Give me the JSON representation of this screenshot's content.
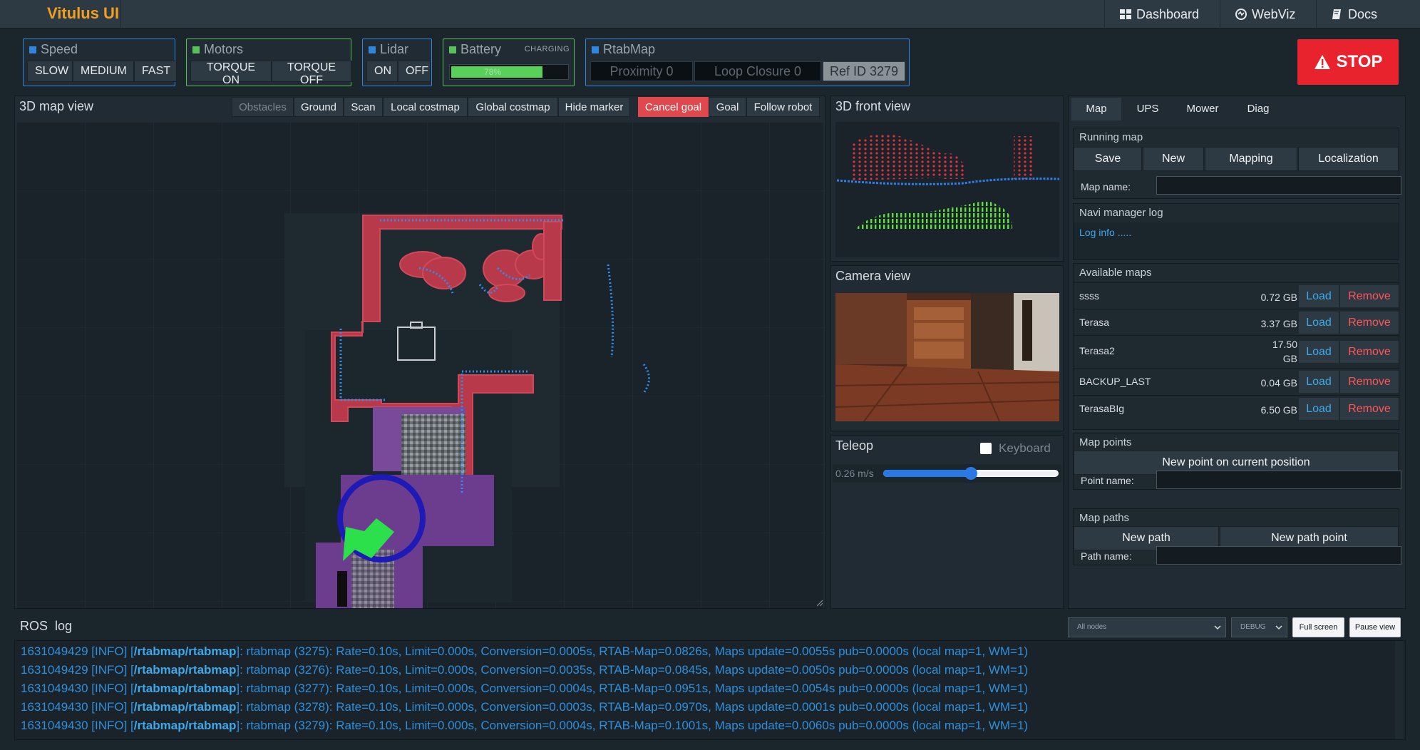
{
  "nav": {
    "brand": "Vitulus UI",
    "links": [
      "Dashboard",
      "WebViz",
      "Docs"
    ]
  },
  "status": {
    "speed": {
      "title": "Speed",
      "buttons": [
        "SLOW",
        "MEDIUM",
        "FAST"
      ],
      "color": "#2e86e0"
    },
    "motors": {
      "title": "Motors",
      "buttons": [
        "TORQUE ON",
        "TORQUE OFF"
      ],
      "color": "#58c159"
    },
    "lidar": {
      "title": "Lidar",
      "buttons": [
        "ON",
        "OFF"
      ],
      "color": "#2e86e0"
    },
    "battery": {
      "title": "Battery",
      "state": "CHARGING",
      "percent_label": "78%",
      "level": 0.78,
      "color": "#58c159"
    },
    "rtabmap": {
      "title": "RtabMap",
      "proximity": "Proximity 0",
      "loop_closure": "Loop Closure 0",
      "ref_id": "Ref ID 3279",
      "color": "#2e86e0"
    }
  },
  "stop": {
    "label": "STOP"
  },
  "map3d": {
    "title": "3D map view",
    "buttons": [
      "Obstacles",
      "Ground",
      "Scan",
      "Local costmap",
      "Global costmap",
      "Hide marker"
    ],
    "goal_buttons": [
      "Cancel goal",
      "Goal",
      "Follow robot"
    ]
  },
  "front_view": {
    "title": "3D front view"
  },
  "camera_view": {
    "title": "Camera view"
  },
  "teleop": {
    "title": "Teleop",
    "keyboard_label": "Keyboard",
    "speed_label": "0.26 m/s",
    "slider_level": 0.5
  },
  "right": {
    "tabs": [
      "Map",
      "UPS",
      "Mower",
      "Diag"
    ],
    "running_map": {
      "title": "Running map",
      "buttons": [
        "Save",
        "New",
        "Mapping",
        "Localization"
      ],
      "map_name_label": "Map name:"
    },
    "navi_log": {
      "title": "Navi manager log",
      "text": "Log info ....."
    },
    "available_maps": {
      "title": "Available maps",
      "load_label": "Load",
      "remove_label": "Remove",
      "rows": [
        {
          "name": "ssss",
          "size": "0.72 GB"
        },
        {
          "name": "Terasa",
          "size": "3.37 GB"
        },
        {
          "name": "Terasa2",
          "size": "17.50 GB"
        },
        {
          "name": "BACKUP_LAST",
          "size": "0.04 GB"
        },
        {
          "name": "TerasaBIg",
          "size": "6.50 GB"
        }
      ]
    },
    "map_points": {
      "title": "Map points",
      "button": "New point on current position",
      "label": "Point name:"
    },
    "map_paths": {
      "title": "Map paths",
      "buttons": [
        "New path",
        "New path point"
      ],
      "label": "Path name:"
    }
  },
  "ros_log": {
    "title": "ROS  log",
    "node_filter": "All nodes",
    "level_filter": "DEBUG",
    "fullscreen_label": "Full screen",
    "pause_label": "Pause view",
    "lines": [
      {
        "ts": "1631049429 [INFO] [",
        "node": "/rtabmap/rtabmap",
        "msg": "]: rtabmap (3275): Rate=0.10s, Limit=0.000s, Conversion=0.0005s, RTAB-Map=0.0826s, Maps update=0.0055s pub=0.0000s (local map=1, WM=1)"
      },
      {
        "ts": "1631049429 [INFO] [",
        "node": "/rtabmap/rtabmap",
        "msg": "]: rtabmap (3276): Rate=0.10s, Limit=0.000s, Conversion=0.0035s, RTAB-Map=0.0845s, Maps update=0.0050s pub=0.0000s (local map=1, WM=1)"
      },
      {
        "ts": "1631049430 [INFO] [",
        "node": "/rtabmap/rtabmap",
        "msg": "]: rtabmap (3277): Rate=0.10s, Limit=0.000s, Conversion=0.0004s, RTAB-Map=0.0951s, Maps update=0.0054s pub=0.0000s (local map=1, WM=1)"
      },
      {
        "ts": "1631049430 [INFO] [",
        "node": "/rtabmap/rtabmap",
        "msg": "]: rtabmap (3278): Rate=0.10s, Limit=0.000s, Conversion=0.0003s, RTAB-Map=0.0970s, Maps update=0.0001s pub=0.0000s (local map=1, WM=1)"
      },
      {
        "ts": "1631049430 [INFO] [",
        "node": "/rtabmap/rtabmap",
        "msg": "]: rtabmap (3279): Rate=0.10s, Limit=0.000s, Conversion=0.0004s, RTAB-Map=0.1001s, Maps update=0.0060s pub=0.0000s (local map=1, WM=1)"
      }
    ]
  }
}
